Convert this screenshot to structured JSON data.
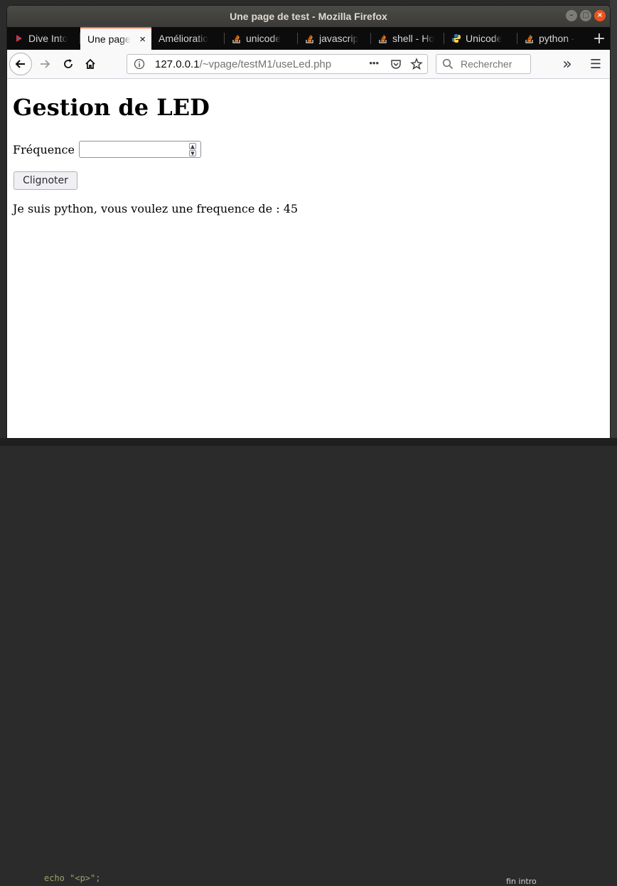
{
  "window": {
    "title": "Une page de test - Mozilla Firefox",
    "controls": {
      "minimize": "–",
      "maximize": "□",
      "close": "×"
    }
  },
  "tabs": [
    {
      "label": "Dive Into",
      "icon": "dive-into-favicon",
      "active": false
    },
    {
      "label": "Une page",
      "icon": "",
      "active": true,
      "close": "×"
    },
    {
      "label": "Amélioratio",
      "icon": "",
      "active": false
    },
    {
      "label": "unicode",
      "icon": "stackoverflow-icon",
      "active": false
    },
    {
      "label": "javascrip",
      "icon": "stackoverflow-icon",
      "active": false
    },
    {
      "label": "shell - Ho",
      "icon": "stackoverflow-icon",
      "active": false
    },
    {
      "label": "Unicode",
      "icon": "python-icon",
      "active": false
    },
    {
      "label": "python -",
      "icon": "stackoverflow-icon",
      "active": false
    }
  ],
  "newtab": "+",
  "nav": {
    "url_host": "127.0.0.1",
    "url_path": "/~vpage/testM1/useLed.php",
    "page_actions": "•••",
    "search_placeholder": "Rechercher",
    "overflow": "»",
    "menu": "☰"
  },
  "page": {
    "heading": "Gestion de LED",
    "freq_label": "Fréquence",
    "freq_value": "",
    "button_label": "Clignoter",
    "result_text": "Je suis python, vous voulez une frequence de : 45"
  },
  "background": {
    "bottom_code": "echo \"<p>\";",
    "bottom_right": "fin intro"
  },
  "colors": {
    "accent": "#ff7139",
    "close": "#e95420",
    "tabbar": "#0c0c0d"
  }
}
